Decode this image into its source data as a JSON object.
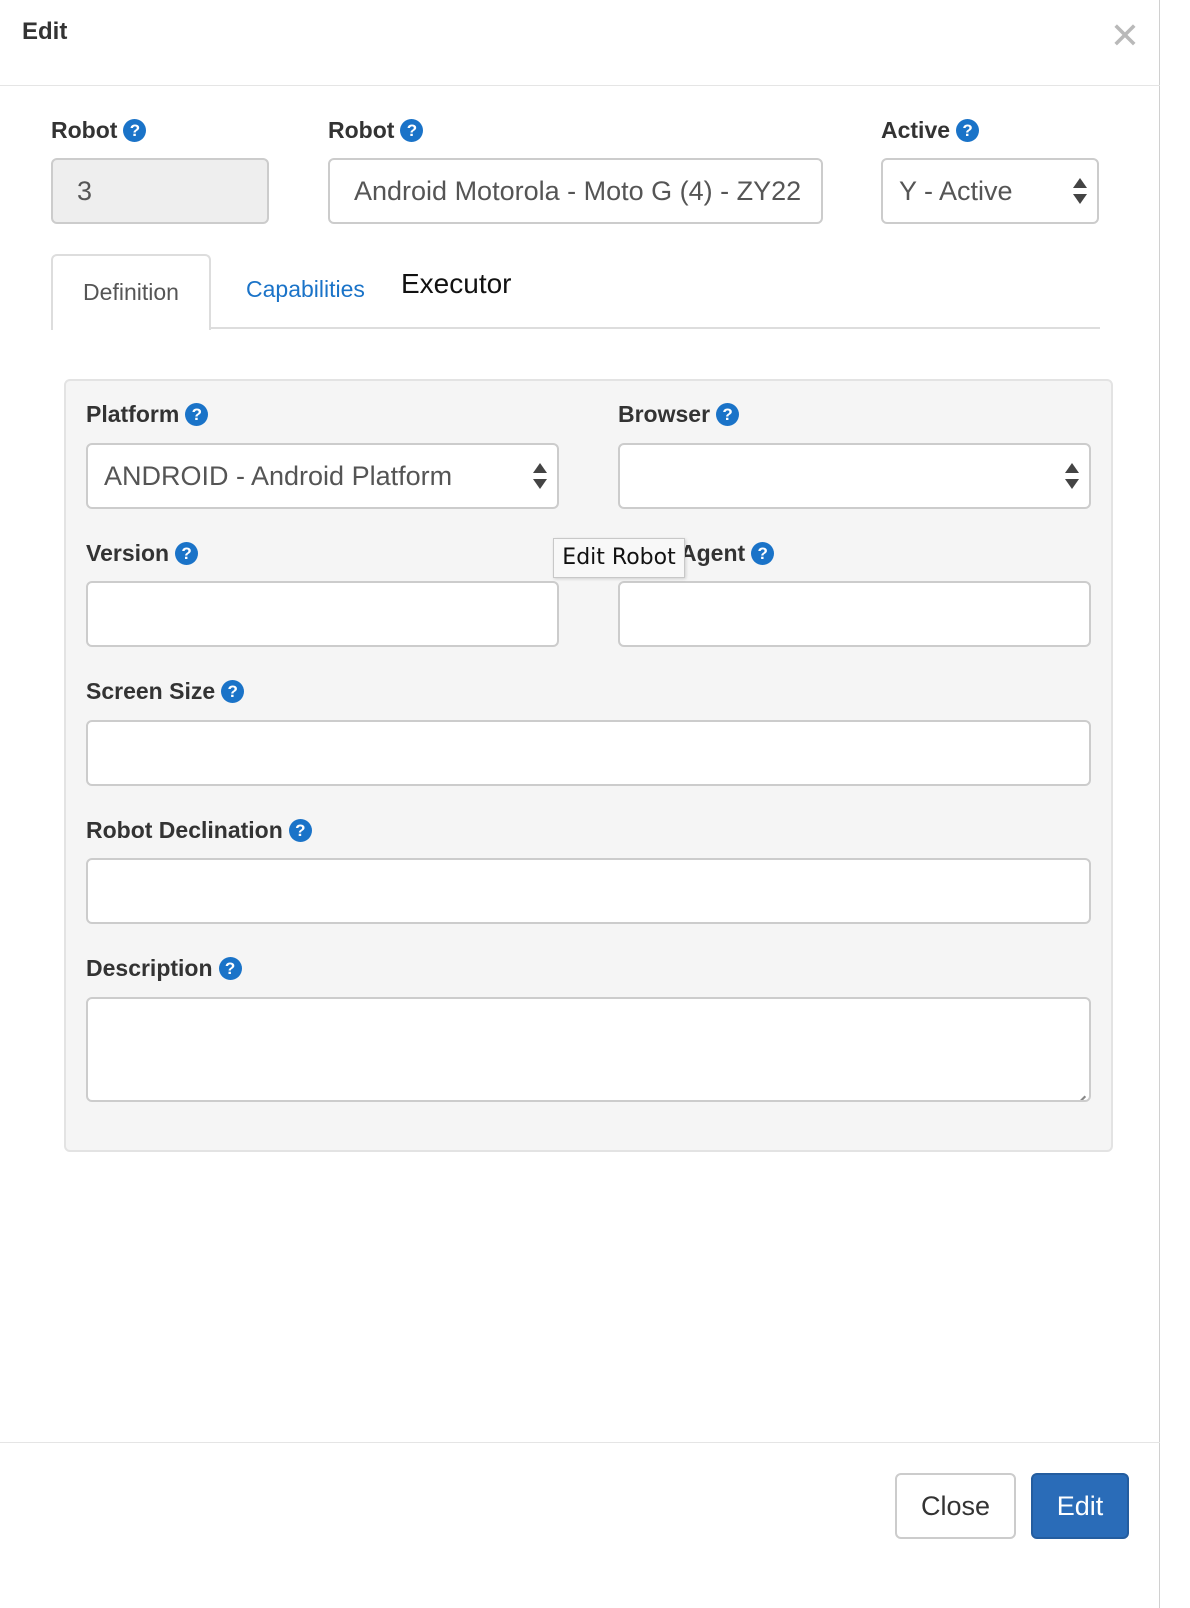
{
  "modal": {
    "title": "Edit",
    "close_icon": "close-icon"
  },
  "header_fields": {
    "robot_id": {
      "label": "Robot",
      "value": "3"
    },
    "robot_name": {
      "label": "Robot",
      "value": "Android Motorola - Moto G (4) - ZY22"
    },
    "active": {
      "label": "Active",
      "value": "Y - Active"
    }
  },
  "help_glyph": "?",
  "tabs": [
    {
      "label": "Definition",
      "state": "active"
    },
    {
      "label": "Capabilities",
      "state": "link"
    },
    {
      "label": "Executor",
      "state": "plain"
    }
  ],
  "definition": {
    "platform": {
      "label": "Platform",
      "value": "ANDROID - Android Platform"
    },
    "browser": {
      "label": "Browser",
      "value": ""
    },
    "version": {
      "label": "Version",
      "value": ""
    },
    "user_agent": {
      "label": "Agent",
      "value": ""
    },
    "screen_size": {
      "label": "Screen Size",
      "value": ""
    },
    "robot_declination": {
      "label": "Robot Declination",
      "value": ""
    },
    "description": {
      "label": "Description",
      "value": ""
    }
  },
  "tooltip": {
    "text": "Edit Robot"
  },
  "footer": {
    "close_label": "Close",
    "edit_label": "Edit"
  },
  "colors": {
    "primary": "#2a6cb8",
    "help_icon": "#1a73c8",
    "link": "#1a73c8"
  }
}
